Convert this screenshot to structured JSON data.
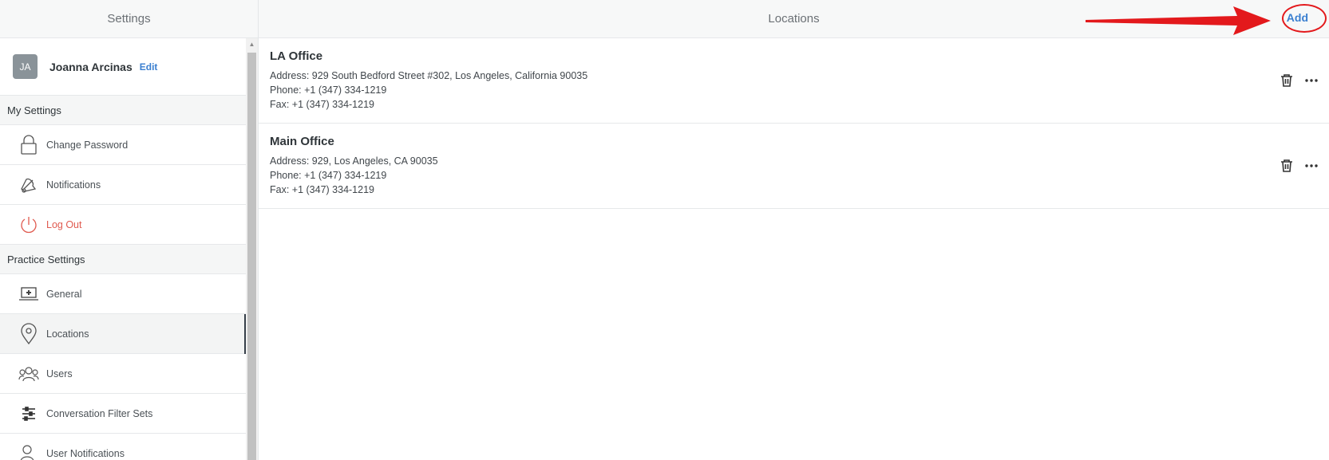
{
  "sidebar": {
    "header_title": "Settings",
    "profile": {
      "initials": "JA",
      "name": "Joanna Arcinas",
      "edit_label": "Edit"
    },
    "my_settings": {
      "title": "My Settings",
      "items": [
        {
          "label": "Change Password",
          "icon": "lock-icon"
        },
        {
          "label": "Notifications",
          "icon": "bell-icon"
        },
        {
          "label": "Log Out",
          "icon": "power-icon"
        }
      ]
    },
    "practice_settings": {
      "title": "Practice Settings",
      "items": [
        {
          "label": "General",
          "icon": "laptop-icon"
        },
        {
          "label": "Locations",
          "icon": "map-pin-icon",
          "active": true
        },
        {
          "label": "Users",
          "icon": "users-icon"
        },
        {
          "label": "Conversation Filter Sets",
          "icon": "sliders-icon"
        },
        {
          "label": "User Notifications",
          "icon": "user-bell-icon"
        }
      ]
    }
  },
  "main": {
    "header_title": "Locations",
    "add_label": "Add",
    "locations": [
      {
        "name": "LA Office",
        "address": "Address: 929 South Bedford Street #302, Los Angeles, California 90035",
        "phone": "Phone: +1 (347) 334-1219",
        "fax": "Fax: +1 (347) 334-1219"
      },
      {
        "name": "Main Office",
        "address": "Address: 929, Los Angeles, CA 90035",
        "phone": "Phone: +1 (347) 334-1219",
        "fax": "Fax: +1 (347) 334-1219"
      }
    ]
  },
  "colors": {
    "accent": "#3a7fd0",
    "logout": "#e05a4f",
    "annotation_red": "#e3191c"
  }
}
